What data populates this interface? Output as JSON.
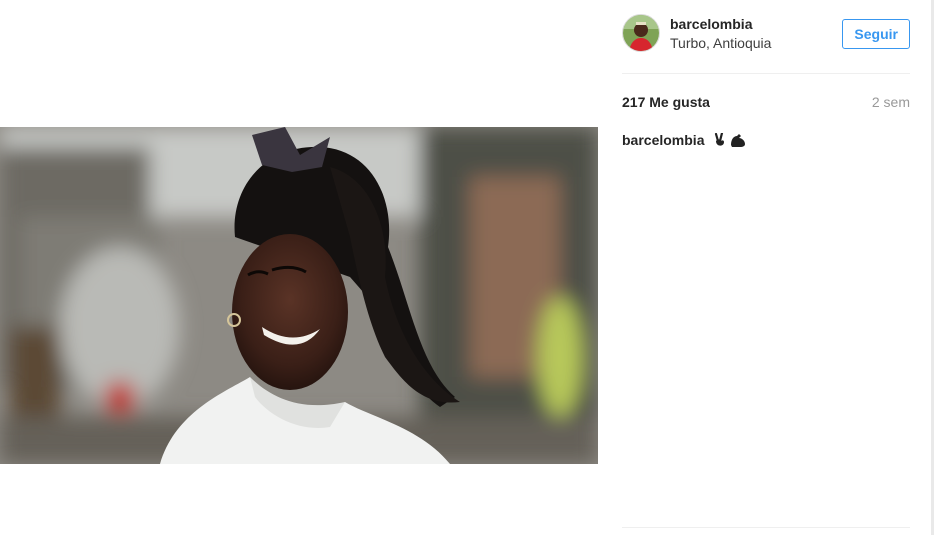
{
  "post": {
    "username": "barcelombia",
    "location": "Turbo, Antioquia",
    "follow_label": "Seguir",
    "likes": "217 Me gusta",
    "age": "2 sem",
    "caption_user": "barcelombia",
    "caption_icons": [
      "victory-hand-icon",
      "flexed-biceps-icon"
    ]
  },
  "colors": {
    "follow_blue": "#3897f0",
    "text": "#262626",
    "muted": "#999999",
    "divider": "#efefef"
  }
}
